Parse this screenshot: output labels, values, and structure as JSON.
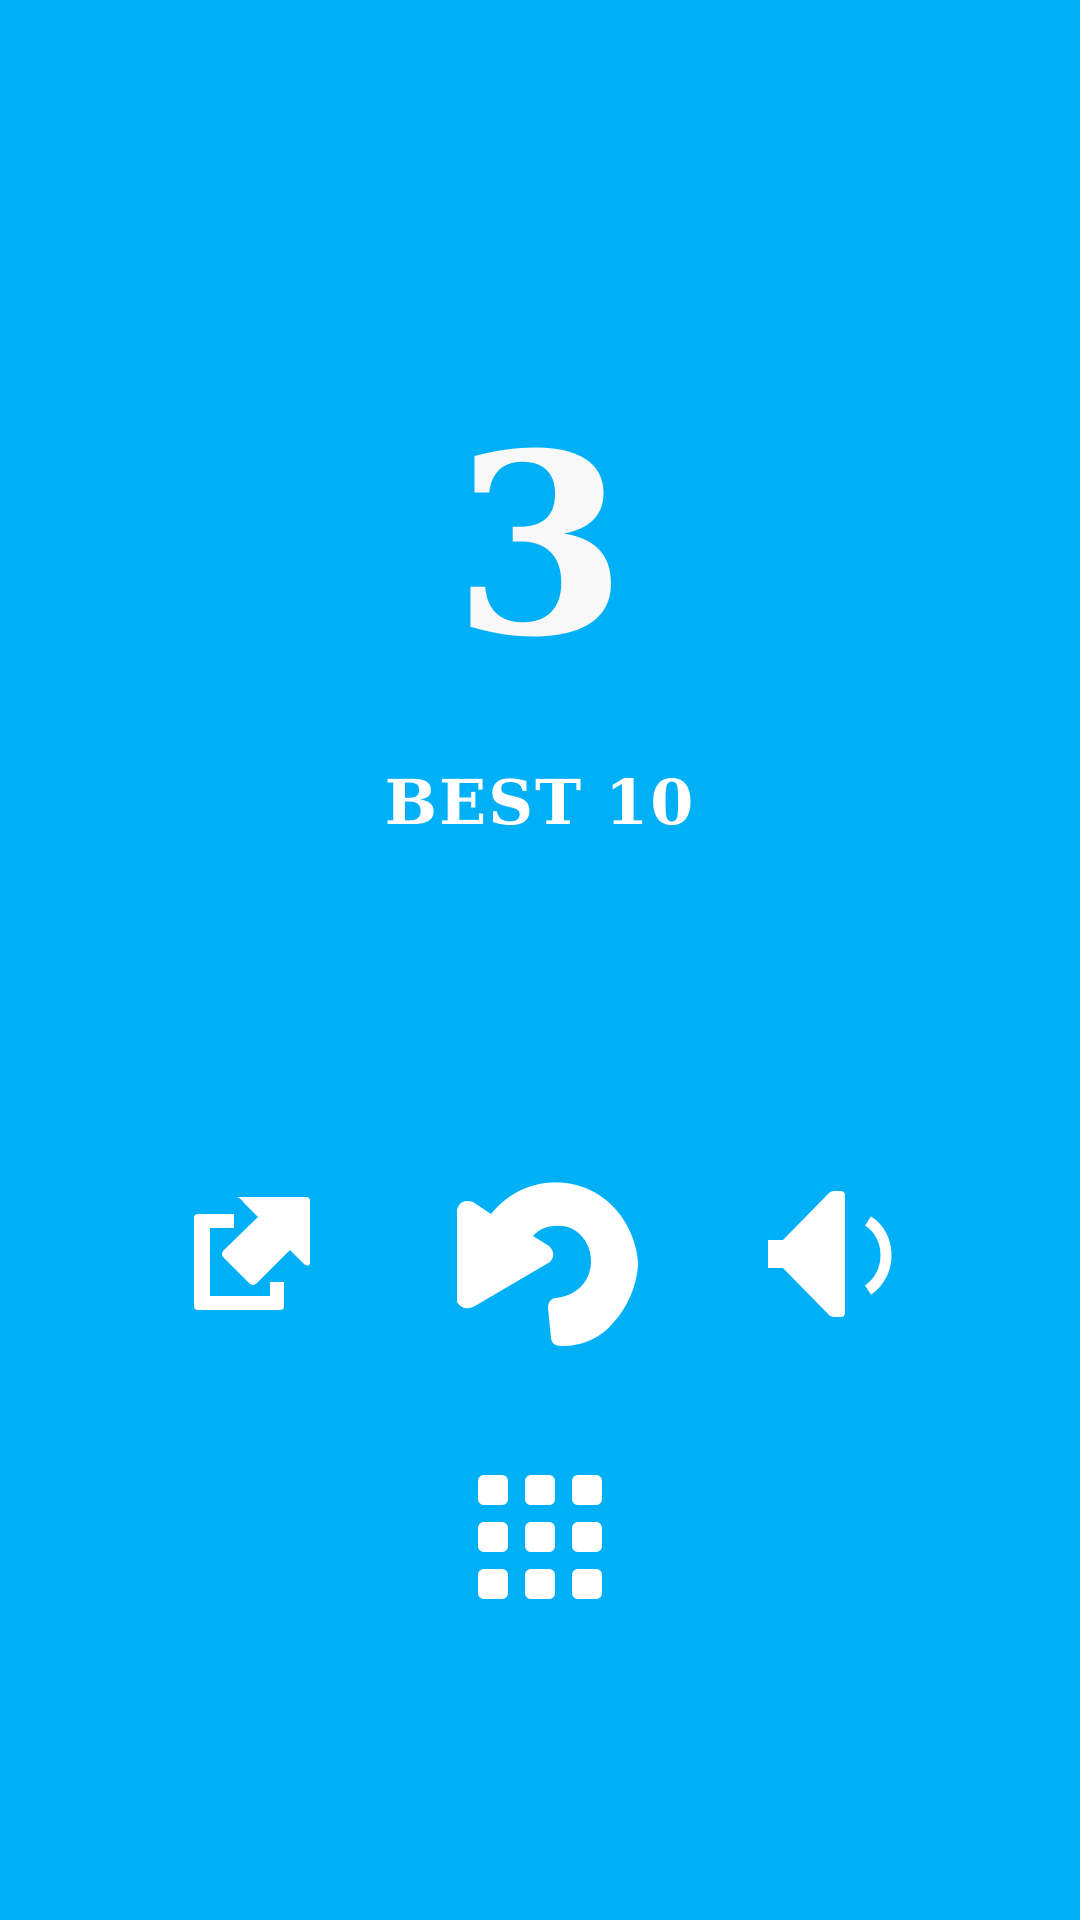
{
  "game": {
    "score": "3",
    "best_label": "BEST",
    "best_value": "10"
  },
  "buttons": [
    {
      "id": "share",
      "icon": "share-external-icon"
    },
    {
      "id": "restart",
      "icon": "restart-icon"
    },
    {
      "id": "sound",
      "icon": "speaker-volume-icon"
    },
    {
      "id": "menu",
      "icon": "grid-menu-icon"
    }
  ],
  "colors": {
    "background": "#00B0F7",
    "foreground": "#FFFFFF"
  }
}
